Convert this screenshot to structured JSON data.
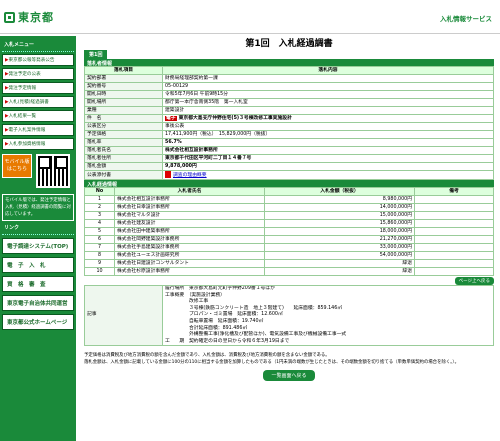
{
  "header": {
    "logo_text": "東京都",
    "service": "入札情報サービス"
  },
  "sidebar": {
    "menu_title": "入札メニュー",
    "items": [
      {
        "label": "東京都公報等発表公告"
      },
      {
        "label": "発注予定の公表"
      },
      {
        "label": "発注予定情報"
      },
      {
        "label": "入札(見積)経過調書"
      },
      {
        "label": "入札結果一覧"
      },
      {
        "label": "電子入札案件情報"
      },
      {
        "label": "入札参加資格情報"
      }
    ],
    "mobile_label": "モバイル版 はこちら",
    "mobile_note": "モバイル版では、発注予定情報と入札（見積）経過調書の閲覧に対応しています。",
    "links_title": "リンク",
    "buttons": [
      {
        "label": "電子調達システム(TOP)"
      },
      {
        "label": "電　子　入　札"
      },
      {
        "label": "資　格　審　査"
      },
      {
        "label": "東京電子自治体共同運営"
      },
      {
        "label": "東京都公式ホームページ"
      }
    ]
  },
  "main": {
    "title": "第1回　入札経過調書",
    "tab": "第1回",
    "section1": "落札者情報",
    "col_item": "落札項目",
    "col_content": "落札内容",
    "rows": [
      {
        "label": "契約部署",
        "value": "財務局経理部契約第一課"
      },
      {
        "label": "契約番号",
        "value": "05-00129"
      },
      {
        "label": "開札日時",
        "value": "令和5年7月6日 午前9時15分"
      },
      {
        "label": "開札場所",
        "value": "都庁第一本庁舎南側35階　第一入札室"
      },
      {
        "label": "業種",
        "value": "建築設計"
      },
      {
        "label": "件　名",
        "value": "東京都大島支庁仲野住宅(5)３号棟改修工事実施設計",
        "badge": "電子"
      },
      {
        "label": "公表区分",
        "value": "事後公表"
      },
      {
        "label": "予定価格",
        "value": "17,411,900円（税込）　15,829,000円（税抜）"
      },
      {
        "label": "落札率",
        "value": "56.7%"
      },
      {
        "label": "落札者氏名",
        "value": "株式会社相互設計事務所"
      },
      {
        "label": "落札者住所",
        "value": "東京都千代田区平河町二丁目１４番７号"
      },
      {
        "label": "落札金額",
        "value": "9,878,000円"
      },
      {
        "label": "公表添付書",
        "value": "調査の理由概要"
      }
    ],
    "section2": "入札経過情報",
    "bid_headers": [
      "No",
      "入札者氏名",
      "入札金額（税抜）",
      "備考"
    ],
    "bids": [
      {
        "no": "1",
        "name": "株式会社相互設計事務所",
        "amount": "8,980,000円",
        "note": ""
      },
      {
        "no": "2",
        "name": "株式会社日幸設計事務所",
        "amount": "14,000,000円",
        "note": ""
      },
      {
        "no": "3",
        "name": "株式会社マルタ設計",
        "amount": "15,000,000円",
        "note": ""
      },
      {
        "no": "4",
        "name": "株式会社建友設計",
        "amount": "15,860,000円",
        "note": ""
      },
      {
        "no": "5",
        "name": "株式会社田中建築事務所",
        "amount": "18,000,000円",
        "note": ""
      },
      {
        "no": "6",
        "name": "株式会社岡野建築設計事務所",
        "amount": "21,270,000円",
        "note": ""
      },
      {
        "no": "7",
        "name": "株式会社手島建築設計事務所",
        "amount": "33,000,000円",
        "note": ""
      },
      {
        "no": "8",
        "name": "株式会社ユーエス計画研究所",
        "amount": "54,000,000円",
        "note": ""
      },
      {
        "no": "9",
        "name": "株式会社日建設計コンサルタント",
        "amount": "辞退",
        "note": ""
      },
      {
        "no": "10",
        "name": "株式会社杉原設計事務所",
        "amount": "辞退",
        "note": ""
      }
    ],
    "pager": "ページ上へ戻る",
    "kiji_label": "記事",
    "kiji_lines": [
      "履行場所　東京都大島町元町字仲野209番１号ほか",
      "工事概要　（実施設計業務）",
      "　　　　　改修工事",
      "　　　　　３号棟(鉄筋コンクリート造　地上３階建て)　　延床面積：859.146㎡",
      "　　　　　プロパン・ゴミ置場　延床面積：12.600㎡",
      "　　　　　自転車置場　延床面積：19.740㎡",
      "　　　　　合計延床面積：891.486㎡",
      "　　　　　外構整備工事(浄化槽及び配管ほか)、電気設備工事及び機械設備工事一式",
      "工　　期　契約確定の日の翌日から令和６年3月19日まで"
    ],
    "notes": [
      "予定価格は消費税及び地方消費税の額を含んだ金額であり、入札金額は、消費税及び地方消費税の額を含まない金額である。",
      "落札金額は、入札金額に記載している金額に100分の110に相当する金額を加算したものである（1円未満の端数が生じたときは、その端数金額を切り捨てる（単数単価契約の場合を除く。）。"
    ],
    "back": "一覧画面へ戻る"
  }
}
